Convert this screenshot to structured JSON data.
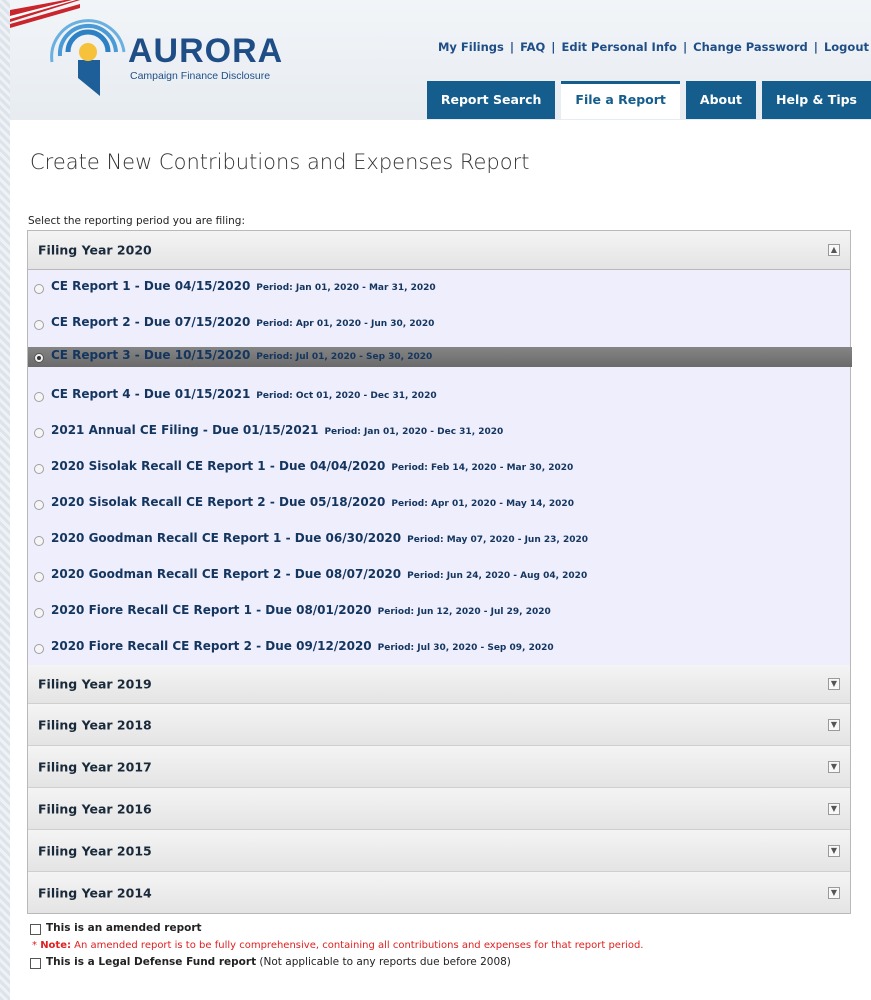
{
  "logo": {
    "title": "AURORA",
    "subtitle": "Campaign Finance Disclosure"
  },
  "top_links": [
    "My Filings",
    "FAQ",
    "Edit Personal Info",
    "Change Password",
    "Logout"
  ],
  "tabs": [
    {
      "label": "Report Search",
      "active": false
    },
    {
      "label": "File a Report",
      "active": true
    },
    {
      "label": "About",
      "active": false
    },
    {
      "label": "Help & Tips",
      "active": false
    }
  ],
  "page_title": "Create New Contributions and Expenses Report",
  "select_label": "Select the reporting period you are filing:",
  "expanded_year": "Filing Year 2020",
  "reports": [
    {
      "title": "CE Report 1 - Due 04/15/2020",
      "period": "Period: Jan 01, 2020 - Mar 31, 2020",
      "selected": false
    },
    {
      "title": "CE Report 2 - Due 07/15/2020",
      "period": "Period: Apr 01, 2020 - Jun 30, 2020",
      "selected": false
    },
    {
      "title": "CE Report 3 - Due 10/15/2020",
      "period": "Period: Jul 01, 2020 - Sep 30, 2020",
      "selected": true
    },
    {
      "title": "CE Report 4 - Due 01/15/2021",
      "period": "Period: Oct 01, 2020 - Dec 31, 2020",
      "selected": false
    },
    {
      "title": "2021 Annual CE Filing - Due 01/15/2021",
      "period": "Period: Jan 01, 2020 - Dec 31, 2020",
      "selected": false
    },
    {
      "title": "2020 Sisolak Recall CE Report 1 - Due 04/04/2020",
      "period": "Period: Feb 14, 2020 - Mar 30, 2020",
      "selected": false
    },
    {
      "title": "2020 Sisolak Recall CE Report 2 - Due 05/18/2020",
      "period": "Period: Apr 01, 2020 - May 14, 2020",
      "selected": false
    },
    {
      "title": "2020 Goodman Recall CE Report 1 - Due 06/30/2020",
      "period": "Period: May 07, 2020 - Jun 23, 2020",
      "selected": false
    },
    {
      "title": "2020 Goodman Recall CE Report 2 - Due 08/07/2020",
      "period": "Period: Jun 24, 2020 - Aug 04, 2020",
      "selected": false
    },
    {
      "title": "2020 Fiore Recall CE Report 1 - Due 08/01/2020",
      "period": "Period: Jun 12, 2020 - Jul 29, 2020",
      "selected": false
    },
    {
      "title": "2020 Fiore Recall CE Report 2 - Due 09/12/2020",
      "period": "Period: Jul 30, 2020 - Sep 09, 2020",
      "selected": false
    }
  ],
  "collapsed_years": [
    "Filing Year 2019",
    "Filing Year 2018",
    "Filing Year 2017",
    "Filing Year 2016",
    "Filing Year 2015",
    "Filing Year 2014"
  ],
  "options": {
    "amended_label": "This is an amended report",
    "note_prefix": "* ",
    "note_bold": "Note:",
    "note_text": " An amended report is to be fully comprehensive, containing all contributions and expenses for that report period.",
    "legal_label": "This is a Legal Defense Fund report",
    "legal_suffix": " (Not applicable to any reports due before 2008)"
  },
  "colors": {
    "nav_blue": "#145d8c",
    "link_blue": "#1f4e87",
    "selected_row": "#7a7a7a",
    "expanded_bg": "#eeeefd",
    "note_red": "#e02020"
  }
}
